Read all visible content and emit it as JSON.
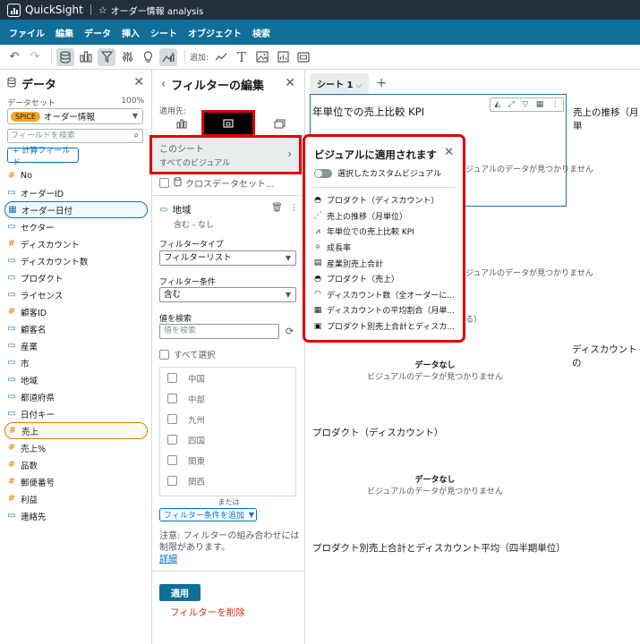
{
  "topbar": {
    "app_name": "QuickSight",
    "analysis_name": "オーダー情報 analysis"
  },
  "menu": [
    "ファイル",
    "編集",
    "データ",
    "挿入",
    "シート",
    "オブジェクト",
    "検索"
  ],
  "toolbar": {
    "add_label": "追加:"
  },
  "data_panel": {
    "title": "データ",
    "dataset_label": "データセット",
    "dataset_pct": "100%",
    "spice_badge": "SPICE",
    "dataset_name": "オーダー情報",
    "field_search_placeholder": "フィールドを検索",
    "calc_field_button": "+ 計算フィールド",
    "fields": [
      {
        "name": "No",
        "type": "measure",
        "icon": "#",
        "state": ""
      },
      {
        "name": "オーダーID",
        "type": "dimension",
        "icon": "▭",
        "state": ""
      },
      {
        "name": "オーダー日付",
        "type": "date",
        "icon": "▦",
        "state": "selected-dimension"
      },
      {
        "name": "セクター",
        "type": "dimension",
        "icon": "▭",
        "state": ""
      },
      {
        "name": "ディスカウント",
        "type": "measure",
        "icon": "#",
        "state": ""
      },
      {
        "name": "ディスカウント数",
        "type": "dimension",
        "icon": "▭",
        "state": ""
      },
      {
        "name": "プロダクト",
        "type": "dimension",
        "icon": "▭",
        "state": ""
      },
      {
        "name": "ライセンス",
        "type": "dimension",
        "icon": "▭",
        "state": ""
      },
      {
        "name": "顧客ID",
        "type": "measure",
        "icon": "#",
        "state": ""
      },
      {
        "name": "顧客名",
        "type": "dimension",
        "icon": "▭",
        "state": ""
      },
      {
        "name": "産業",
        "type": "dimension",
        "icon": "▭",
        "state": ""
      },
      {
        "name": "市",
        "type": "dimension",
        "icon": "▭",
        "state": ""
      },
      {
        "name": "地域",
        "type": "dimension",
        "icon": "▭",
        "state": ""
      },
      {
        "name": "都道府県",
        "type": "dimension",
        "icon": "▭",
        "state": ""
      },
      {
        "name": "日付キー",
        "type": "dimension",
        "icon": "▭",
        "state": ""
      },
      {
        "name": "売上",
        "type": "measure",
        "icon": "#",
        "state": "selected-measure"
      },
      {
        "name": "売上%",
        "type": "measure",
        "icon": "#",
        "state": ""
      },
      {
        "name": "品数",
        "type": "measure",
        "icon": "#",
        "state": ""
      },
      {
        "name": "郵便番号",
        "type": "measure",
        "icon": "#",
        "state": ""
      },
      {
        "name": "利益",
        "type": "measure",
        "icon": "#",
        "state": ""
      },
      {
        "name": "連絡先",
        "type": "dimension",
        "icon": "▭",
        "state": ""
      }
    ]
  },
  "filter_panel": {
    "title": "フィルターの編集",
    "apply_to_label": "適用先:",
    "scope_title": "このシート",
    "scope_sub": "すべてのビジュアル",
    "cross_dataset": "クロスデータセット...",
    "field_name": "地域",
    "field_summary": "含む - なし",
    "filter_type_label": "フィルタータイプ",
    "filter_type_value": "フィルターリスト",
    "filter_cond_label": "フィルター条件",
    "filter_cond_value": "含む",
    "value_search_label": "値を検索",
    "value_search_placeholder": "値を検索",
    "select_all": "すべて選択",
    "values": [
      "中国",
      "中部",
      "九州",
      "四国",
      "関東",
      "関西"
    ],
    "or_label": "または",
    "add_condition": "フィルター条件を追加",
    "note_text": "注意: フィルターの組み合わせには制限があります。",
    "note_link": "詳細",
    "apply_button": "適用",
    "delete_filter": "フィルターを削除"
  },
  "canvas": {
    "sheet_tab": "シート 1",
    "charts": [
      {
        "title": "年単位での売上比較 KPI"
      },
      {
        "title": "売上の推移（月単"
      },
      {
        "title": "ディスカウントの"
      },
      {
        "title": "プロダクト（ディスカウント）"
      },
      {
        "title": "プロダクト別売上合計とディスカウント平均（四半期単位）"
      }
    ],
    "no_data_title": "データなし",
    "no_data_sub": "ビジュアルのデータが見つかりません",
    "partial_text": "する）"
  },
  "popover": {
    "title": "ビジュアルに適用されます",
    "toggle_label": "選択したカスタムビジュアル",
    "visuals": [
      {
        "icon": "donut",
        "label": "プロダクト（ディスカウント）"
      },
      {
        "icon": "line",
        "label": "売上の推移（月単位）"
      },
      {
        "icon": "kpi",
        "label": "年単位での売上比較 KPI"
      },
      {
        "icon": "insight",
        "label": "成長率"
      },
      {
        "icon": "bar",
        "label": "産業別売上合計"
      },
      {
        "icon": "donut",
        "label": "プロダクト（売上）"
      },
      {
        "icon": "gauge",
        "label": "ディスカウント数（全オーダーに..."
      },
      {
        "icon": "table",
        "label": "ディスカウントの平均割合（月単..."
      },
      {
        "icon": "combo",
        "label": "プロダクト別売上合計とディスカ..."
      }
    ]
  }
}
